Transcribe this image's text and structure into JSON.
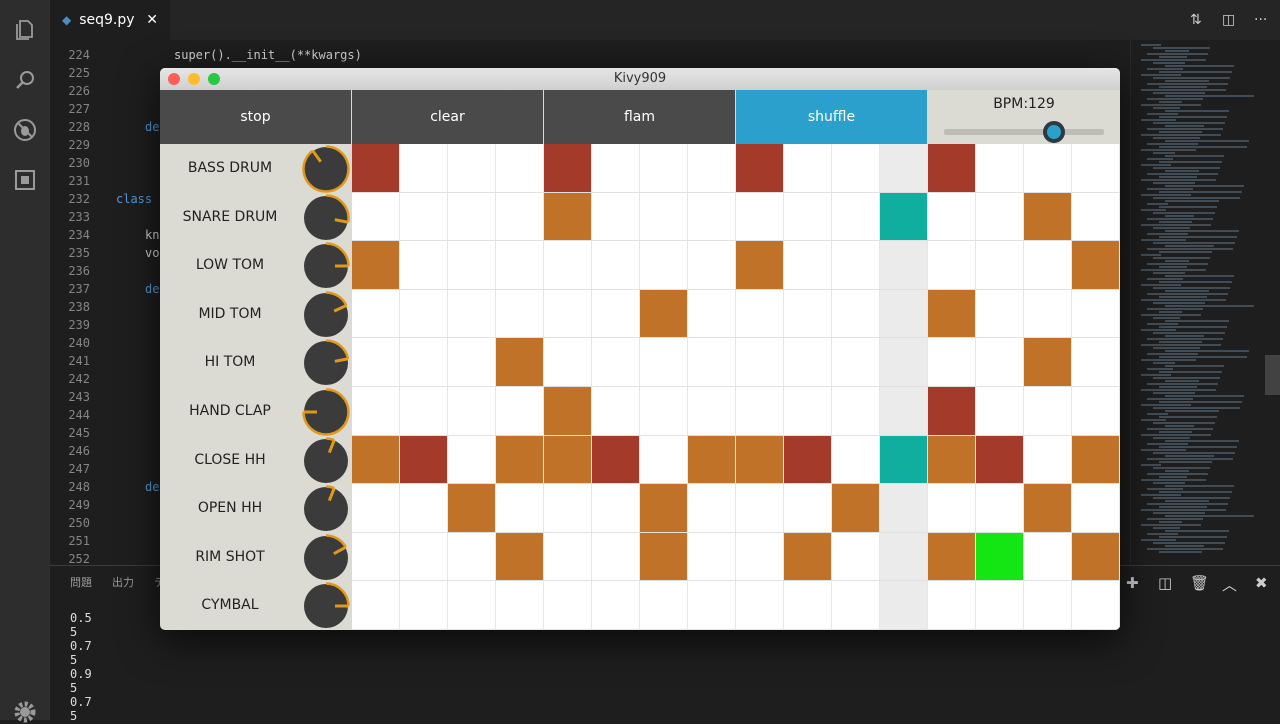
{
  "editor": {
    "tab": {
      "filename": "seq9.py",
      "close": "✕"
    },
    "line_numbers": [
      224,
      225,
      226,
      227,
      228,
      229,
      230,
      231,
      232,
      233,
      234,
      235,
      236,
      237,
      238,
      239,
      240,
      241,
      242,
      243,
      244,
      245,
      246,
      247,
      248,
      249,
      250,
      251,
      252
    ],
    "code": [
      {
        "line": 224,
        "indent": 8,
        "text": "super().__init__(**kwargs)"
      },
      {
        "line": 228,
        "indent": 4,
        "text": "de"
      },
      {
        "line": 232,
        "indent": 0,
        "text": "class"
      },
      {
        "line": 234,
        "indent": 4,
        "text": "kn"
      },
      {
        "line": 235,
        "indent": 4,
        "text": "vo"
      },
      {
        "line": 237,
        "indent": 4,
        "text": "de"
      },
      {
        "line": 248,
        "indent": 4,
        "text": "de"
      }
    ],
    "panel": {
      "tabs": [
        "問題",
        "出力",
        "テ"
      ],
      "output": [
        "0.5",
        "5",
        "0.7",
        "5",
        "0.9",
        "5",
        "0.7",
        "5"
      ]
    }
  },
  "app": {
    "title": "Kivy909",
    "buttons": {
      "stop": "stop",
      "clear": "clear",
      "flam": "flam",
      "shuffle": "shuffle"
    },
    "bpm": {
      "label": "BPM:129",
      "value": 129,
      "slider_fraction": 0.69
    },
    "playhead_step": 11,
    "colors": {
      "accent": "#2ba0cc",
      "button": "#4a4a4a",
      "red": "#a33a2a",
      "orange": "#c07228",
      "playhead": "#0fae9f",
      "playhead_empty": "#ebebeb",
      "selected": "#14e614",
      "knob": "#3b3b3b",
      "knob_arc": "#e09a1a",
      "empty": "#ffffff"
    },
    "tracks": [
      {
        "name": "BASS DRUM",
        "knob_value": 0.9,
        "steps": "r...r...r...r..."
      },
      {
        "name": "SNARE DRUM",
        "knob_value": 0.28,
        "steps": "....o......o..o."
      },
      {
        "name": "LOW TOM",
        "knob_value": 0.25,
        "steps": "o.......o......o"
      },
      {
        "name": "MID TOM",
        "knob_value": 0.18,
        "steps": "......o.....o..."
      },
      {
        "name": "HI TOM",
        "knob_value": 0.22,
        "steps": "...o..........o."
      },
      {
        "name": "HAND CLAP",
        "knob_value": 0.75,
        "steps": "....o.......r..."
      },
      {
        "name": "CLOSE HH",
        "knob_value": 0.06,
        "steps": "or.oor.oor.oor.o"
      },
      {
        "name": "OPEN HH",
        "knob_value": 0.06,
        "steps": "..o...o...o...o."
      },
      {
        "name": "RIM SHOT",
        "knob_value": 0.17,
        "steps": "...o..o..o..og.o"
      },
      {
        "name": "CYMBAL",
        "knob_value": 0.25,
        "steps": "................"
      }
    ]
  }
}
